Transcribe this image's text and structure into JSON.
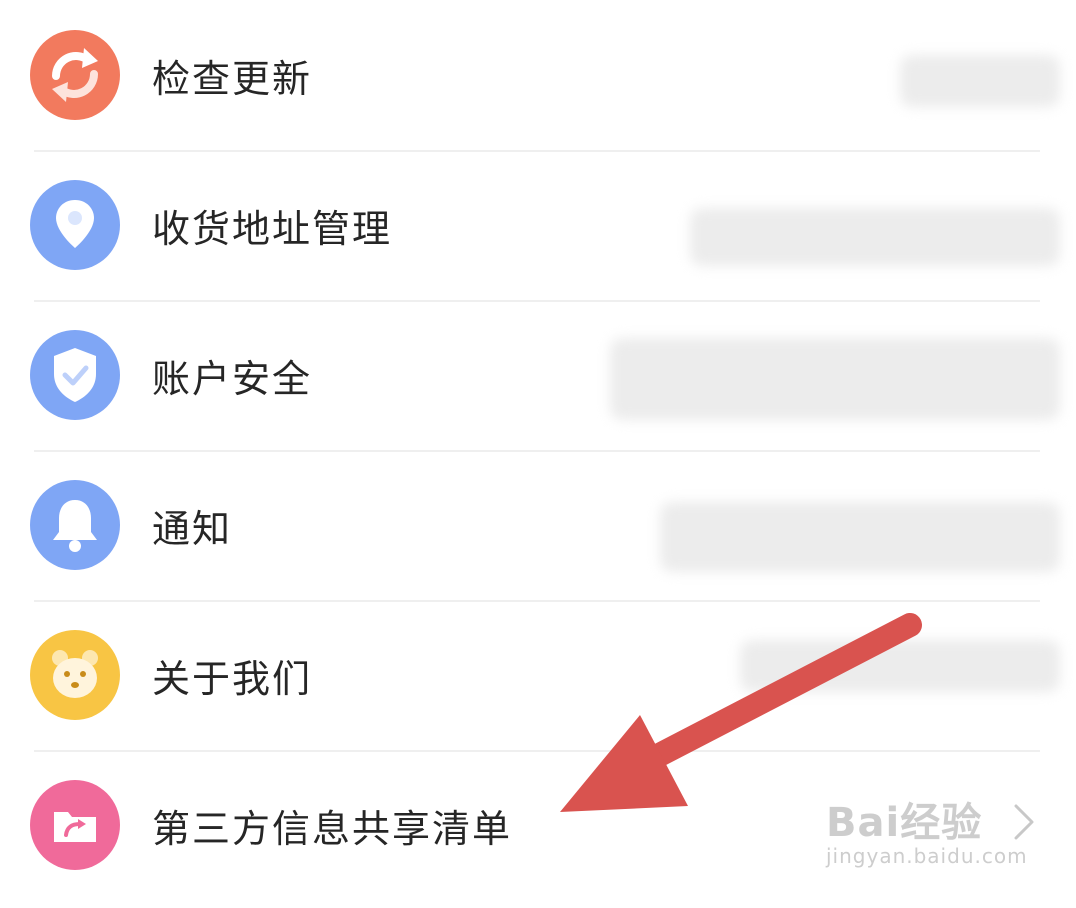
{
  "menu": [
    {
      "label": "检查更新",
      "icon": "refresh-icon",
      "color": "#f27a5e"
    },
    {
      "label": "收货地址管理",
      "icon": "location-pin-icon",
      "color": "#7fa6f5"
    },
    {
      "label": "账户安全",
      "icon": "shield-check-icon",
      "color": "#7fa6f5"
    },
    {
      "label": "通知",
      "icon": "bell-icon",
      "color": "#7fa6f5"
    },
    {
      "label": "关于我们",
      "icon": "mascot-face-icon",
      "color": "#f8c544"
    },
    {
      "label": "第三方信息共享清单",
      "icon": "folder-share-icon",
      "color": "#f06a9a"
    }
  ],
  "annotation": {
    "arrow_color": "#d9534f"
  },
  "watermark": {
    "brand": "Bai经验",
    "url": "jingyan.baidu.com"
  }
}
